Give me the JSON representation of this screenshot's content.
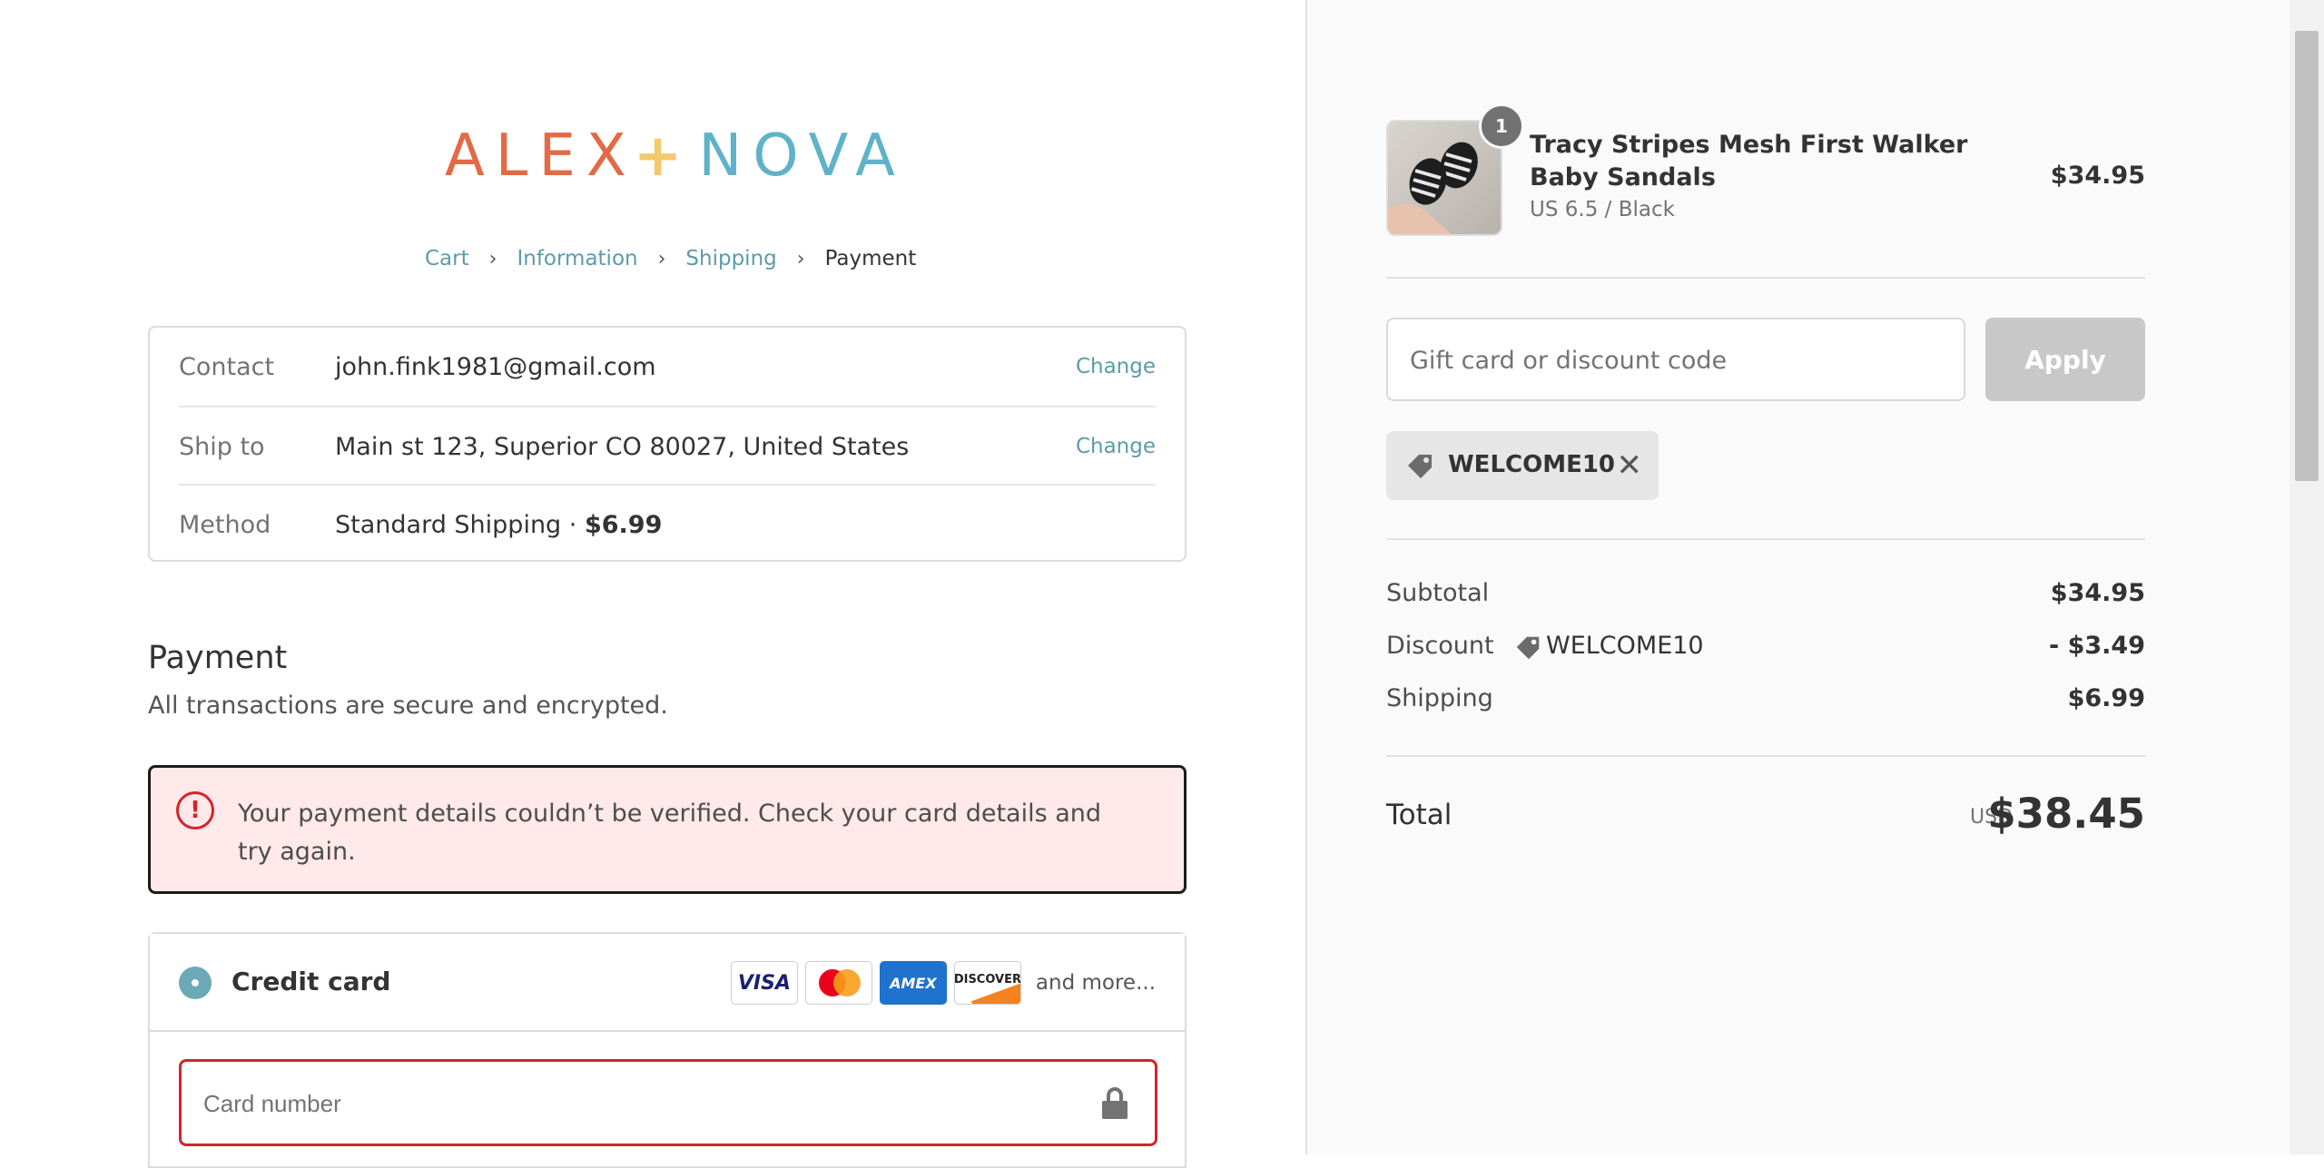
{
  "brand": {
    "part1": "ALEX",
    "plus": "+",
    "part2": "NOVA"
  },
  "breadcrumb": {
    "cart": "Cart",
    "information": "Information",
    "shipping": "Shipping",
    "payment": "Payment"
  },
  "summary": {
    "contact_label": "Contact",
    "contact_value": "john.fink1981@gmail.com",
    "ship_label": "Ship to",
    "ship_value": "Main st 123, Superior CO 80027, United States",
    "method_label": "Method",
    "method_value": "Standard Shipping · ",
    "method_price": "$6.99",
    "change_label": "Change"
  },
  "payment": {
    "title": "Payment",
    "subtitle": "All transactions are secure and encrypted.",
    "error": "Your payment details couldn’t be verified. Check your card details and try again.",
    "method_label": "Credit card",
    "cards": {
      "visa": "VISA",
      "amex": "AMEX",
      "discover": "DISCOVER"
    },
    "and_more": "and more...",
    "card_placeholder": "Card number"
  },
  "cart": {
    "quantity": "1",
    "product_name": "Tracy Stripes Mesh First Walker Baby Sandals",
    "variant": "US 6.5 / Black",
    "price": "$34.95"
  },
  "discount": {
    "placeholder": "Gift card or discount code",
    "apply": "Apply",
    "code": "WELCOME10"
  },
  "totals": {
    "subtotal_label": "Subtotal",
    "subtotal": "$34.95",
    "discount_label": "Discount",
    "discount_code": "WELCOME10",
    "discount": "- $3.49",
    "shipping_label": "Shipping",
    "shipping": "$6.99",
    "total_label": "Total",
    "currency": "USD",
    "total": "$38.45"
  },
  "colors": {
    "accent": "#5a9cab",
    "error": "#d4242a",
    "logo_orange": "#e36a45",
    "logo_blue": "#5fb3c9",
    "logo_plus": "#f3c96b"
  }
}
